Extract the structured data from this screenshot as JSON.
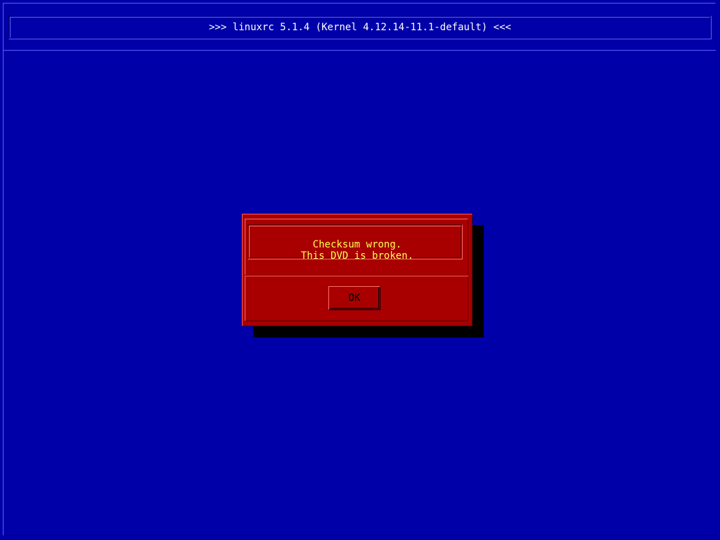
{
  "header": {
    "title": ">>> linuxrc 5.1.4 (Kernel 4.12.14-11.1-default) <<<"
  },
  "dialog": {
    "message_lines": [
      "Checksum wrong.",
      "This DVD is broken."
    ],
    "ok_label": "OK"
  },
  "colors": {
    "background": "#0000a8",
    "dialog_background": "#a80000",
    "message_text": "#ffff54",
    "title_text": "#ffffff",
    "shadow": "#000000"
  }
}
